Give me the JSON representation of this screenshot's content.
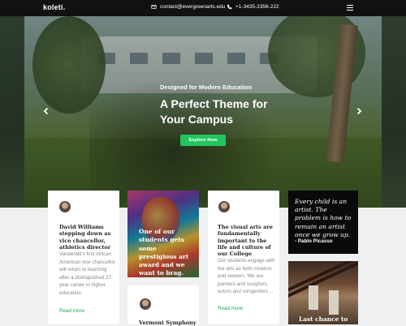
{
  "header": {
    "logo": "koleti.",
    "email": "contact@evergreenarts.edu",
    "phone": "+1-3435-2356-222",
    "menu_icon": "hamburger-icon"
  },
  "hero": {
    "subtitle": "Designed for Modern Education",
    "title": "A Perfect Theme for Your Campus",
    "cta_label": "Explore Now",
    "prev_icon": "chevron-left-icon",
    "next_icon": "chevron-right-icon"
  },
  "cards": {
    "card1": {
      "title": "David Williams stepping down as vice chancellor, athletics director",
      "body": "Vanderbilt's first African American vice chancellor will return to teaching after a distinguished 27-year career in higher education",
      "link": "Read more"
    },
    "art": {
      "text": "One of our students gets some prestigious art award and we want to brag."
    },
    "card3": {
      "title": "The visual arts are fundamentally important to the life and culture of our College",
      "body": "Our students engage with the arts as both creators and viewers. We are painters and sculptors, actors and songwriters…",
      "link": "Read more"
    },
    "quote": {
      "text": "Every child is an artist. The problem is how to remain an artist once we grow up.",
      "author": "- Pablo Picasso"
    },
    "card5": {
      "title": "Vermont Symphony"
    },
    "photo": {
      "text": "Last chance to"
    }
  },
  "colors": {
    "accent": "#22c55e",
    "topbar": "#111111",
    "link": "#22a55a"
  }
}
